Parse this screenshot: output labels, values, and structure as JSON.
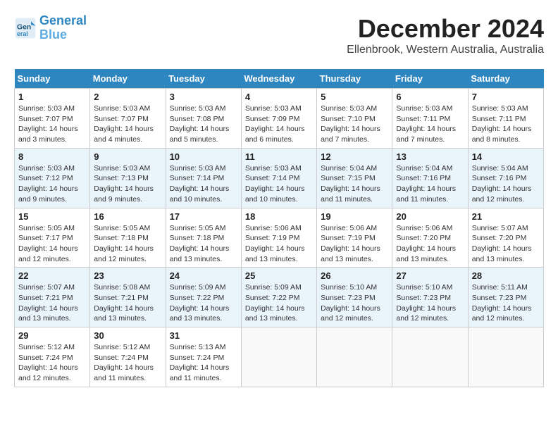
{
  "header": {
    "logo_line1": "General",
    "logo_line2": "Blue",
    "month": "December 2024",
    "location": "Ellenbrook, Western Australia, Australia"
  },
  "weekdays": [
    "Sunday",
    "Monday",
    "Tuesday",
    "Wednesday",
    "Thursday",
    "Friday",
    "Saturday"
  ],
  "weeks": [
    [
      {
        "day": "1",
        "sunrise": "5:03 AM",
        "sunset": "7:07 PM",
        "daylight": "14 hours and 3 minutes."
      },
      {
        "day": "2",
        "sunrise": "5:03 AM",
        "sunset": "7:07 PM",
        "daylight": "14 hours and 4 minutes."
      },
      {
        "day": "3",
        "sunrise": "5:03 AM",
        "sunset": "7:08 PM",
        "daylight": "14 hours and 5 minutes."
      },
      {
        "day": "4",
        "sunrise": "5:03 AM",
        "sunset": "7:09 PM",
        "daylight": "14 hours and 6 minutes."
      },
      {
        "day": "5",
        "sunrise": "5:03 AM",
        "sunset": "7:10 PM",
        "daylight": "14 hours and 7 minutes."
      },
      {
        "day": "6",
        "sunrise": "5:03 AM",
        "sunset": "7:11 PM",
        "daylight": "14 hours and 7 minutes."
      },
      {
        "day": "7",
        "sunrise": "5:03 AM",
        "sunset": "7:11 PM",
        "daylight": "14 hours and 8 minutes."
      }
    ],
    [
      {
        "day": "8",
        "sunrise": "5:03 AM",
        "sunset": "7:12 PM",
        "daylight": "14 hours and 9 minutes."
      },
      {
        "day": "9",
        "sunrise": "5:03 AM",
        "sunset": "7:13 PM",
        "daylight": "14 hours and 9 minutes."
      },
      {
        "day": "10",
        "sunrise": "5:03 AM",
        "sunset": "7:14 PM",
        "daylight": "14 hours and 10 minutes."
      },
      {
        "day": "11",
        "sunrise": "5:03 AM",
        "sunset": "7:14 PM",
        "daylight": "14 hours and 10 minutes."
      },
      {
        "day": "12",
        "sunrise": "5:04 AM",
        "sunset": "7:15 PM",
        "daylight": "14 hours and 11 minutes."
      },
      {
        "day": "13",
        "sunrise": "5:04 AM",
        "sunset": "7:16 PM",
        "daylight": "14 hours and 11 minutes."
      },
      {
        "day": "14",
        "sunrise": "5:04 AM",
        "sunset": "7:16 PM",
        "daylight": "14 hours and 12 minutes."
      }
    ],
    [
      {
        "day": "15",
        "sunrise": "5:05 AM",
        "sunset": "7:17 PM",
        "daylight": "14 hours and 12 minutes."
      },
      {
        "day": "16",
        "sunrise": "5:05 AM",
        "sunset": "7:18 PM",
        "daylight": "14 hours and 12 minutes."
      },
      {
        "day": "17",
        "sunrise": "5:05 AM",
        "sunset": "7:18 PM",
        "daylight": "14 hours and 13 minutes."
      },
      {
        "day": "18",
        "sunrise": "5:06 AM",
        "sunset": "7:19 PM",
        "daylight": "14 hours and 13 minutes."
      },
      {
        "day": "19",
        "sunrise": "5:06 AM",
        "sunset": "7:19 PM",
        "daylight": "14 hours and 13 minutes."
      },
      {
        "day": "20",
        "sunrise": "5:06 AM",
        "sunset": "7:20 PM",
        "daylight": "14 hours and 13 minutes."
      },
      {
        "day": "21",
        "sunrise": "5:07 AM",
        "sunset": "7:20 PM",
        "daylight": "14 hours and 13 minutes."
      }
    ],
    [
      {
        "day": "22",
        "sunrise": "5:07 AM",
        "sunset": "7:21 PM",
        "daylight": "14 hours and 13 minutes."
      },
      {
        "day": "23",
        "sunrise": "5:08 AM",
        "sunset": "7:21 PM",
        "daylight": "14 hours and 13 minutes."
      },
      {
        "day": "24",
        "sunrise": "5:09 AM",
        "sunset": "7:22 PM",
        "daylight": "14 hours and 13 minutes."
      },
      {
        "day": "25",
        "sunrise": "5:09 AM",
        "sunset": "7:22 PM",
        "daylight": "14 hours and 13 minutes."
      },
      {
        "day": "26",
        "sunrise": "5:10 AM",
        "sunset": "7:23 PM",
        "daylight": "14 hours and 12 minutes."
      },
      {
        "day": "27",
        "sunrise": "5:10 AM",
        "sunset": "7:23 PM",
        "daylight": "14 hours and 12 minutes."
      },
      {
        "day": "28",
        "sunrise": "5:11 AM",
        "sunset": "7:23 PM",
        "daylight": "14 hours and 12 minutes."
      }
    ],
    [
      {
        "day": "29",
        "sunrise": "5:12 AM",
        "sunset": "7:24 PM",
        "daylight": "14 hours and 12 minutes."
      },
      {
        "day": "30",
        "sunrise": "5:12 AM",
        "sunset": "7:24 PM",
        "daylight": "14 hours and 11 minutes."
      },
      {
        "day": "31",
        "sunrise": "5:13 AM",
        "sunset": "7:24 PM",
        "daylight": "14 hours and 11 minutes."
      },
      null,
      null,
      null,
      null
    ]
  ]
}
